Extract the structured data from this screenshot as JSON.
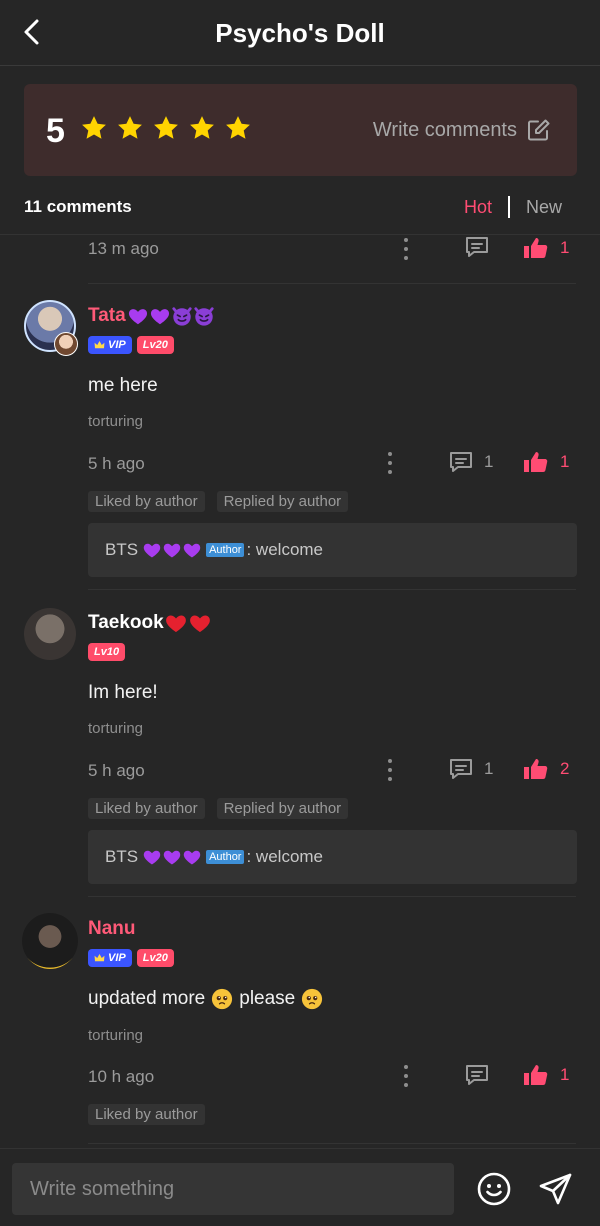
{
  "header": {
    "title": "Psycho's Doll"
  },
  "rating": {
    "score": "5",
    "stars": 5,
    "write_label": "Write comments"
  },
  "list": {
    "count_label": "11 comments",
    "tab_hot": "Hot",
    "tab_new": "New"
  },
  "top_stub": {
    "time": "13 m ago",
    "likes": "1"
  },
  "comments": [
    {
      "user": "Tata",
      "vip": "VIP",
      "level": "Lv20",
      "text": "me here",
      "chapter": "torturing",
      "time": "5 h ago",
      "replies": "1",
      "likes": "1",
      "tags": [
        "Liked by author",
        "Replied by author"
      ],
      "reply_author": "BTS",
      "author_label": "Author",
      "reply_text": ": welcome"
    },
    {
      "user": "Taekook",
      "level": "Lv10",
      "text": "Im here!",
      "chapter": "torturing",
      "time": "5 h ago",
      "replies": "1",
      "likes": "2",
      "tags": [
        "Liked by author",
        "Replied by author"
      ],
      "reply_author": "BTS",
      "author_label": "Author",
      "reply_text": ": welcome"
    },
    {
      "user": "Nanu",
      "vip": "VIP",
      "level": "Lv20",
      "text_a": "updated more",
      "text_b": "please",
      "chapter": "torturing",
      "time": "10 h ago",
      "likes": "1",
      "tags": [
        "Liked by author"
      ]
    }
  ],
  "input": {
    "placeholder": "Write something"
  },
  "colors": {
    "accent": "#ff4c73",
    "vip": "#3b55ff",
    "level": "#ff4c6a",
    "rating_bg": "#3e2c2c"
  }
}
